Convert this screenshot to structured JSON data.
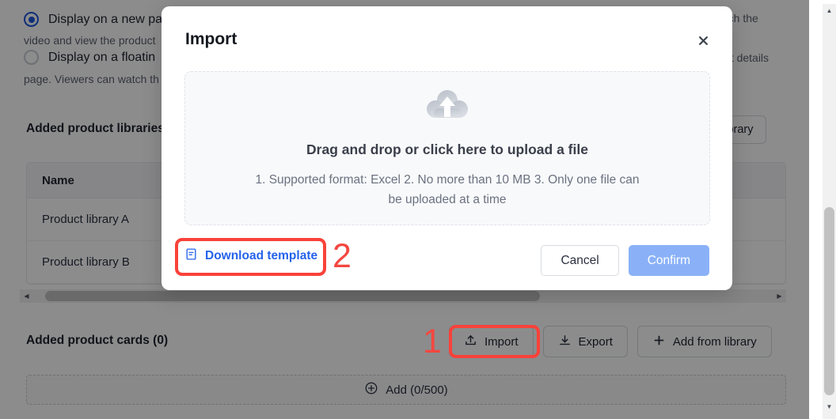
{
  "background": {
    "radio_options": [
      {
        "label": "Display on a new pa",
        "selected": true
      },
      {
        "label": "Display on a floatin",
        "selected": false
      }
    ],
    "helper_line_1": "video and view the product",
    "helper_line_1_right": "atch the",
    "helper_line_2": "page. Viewers can watch th",
    "helper_line_2_right": "uct details",
    "libraries_title": "Added product libraries",
    "library_button_label": "library",
    "table": {
      "columns": [
        "Name"
      ],
      "rows": [
        [
          "Product library A"
        ],
        [
          "Product library B"
        ]
      ]
    },
    "cards_title": "Added product cards (0)",
    "toolbar": [
      {
        "label": "Import",
        "icon": "upload-icon"
      },
      {
        "label": "Export",
        "icon": "download-icon"
      },
      {
        "label": "Add from library",
        "icon": "plus-icon"
      }
    ],
    "add_row_label": "Add (0/500)",
    "add_row_icon": "circle-plus-icon",
    "scrollbar_left_icon": "triangle-left-icon",
    "scrollbar_right_icon": "triangle-right-icon",
    "scrollbar_up_icon": "triangle-up-icon",
    "scrollbar_down_icon": "triangle-down-icon"
  },
  "dialog": {
    "title": "Import",
    "close_icon": "close-icon",
    "dropzone": {
      "icon": "cloud-upload-icon",
      "headline": "Drag and drop or click here to upload a file",
      "description": "1. Supported format: Excel 2. No more than 10 MB 3. Only one file can be uploaded at a time"
    },
    "download_template": {
      "label": "Download template",
      "icon": "file-document-icon"
    },
    "cancel_label": "Cancel",
    "confirm_label": "Confirm"
  },
  "annotations": {
    "marker_1": "1",
    "marker_2": "2",
    "color": "#f4473f"
  }
}
